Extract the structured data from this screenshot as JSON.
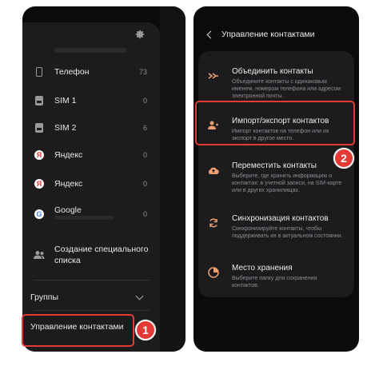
{
  "left": {
    "accounts": [
      {
        "label": "Телефон",
        "count": "73",
        "icon": "phone-icon"
      },
      {
        "label": "SIM 1",
        "count": "0",
        "icon": "sim-icon"
      },
      {
        "label": "SIM 2",
        "count": "6",
        "icon": "sim-icon"
      },
      {
        "label": "Яндекс",
        "count": "0",
        "icon": "yandex-icon"
      },
      {
        "label": "Яндекс",
        "count": "0",
        "icon": "yandex-icon"
      },
      {
        "label": "Google",
        "count": "0",
        "icon": "google-icon"
      }
    ],
    "create_list": "Создание специального списка",
    "groups": "Группы",
    "manage": "Управление контактами",
    "badge": "1"
  },
  "right": {
    "title": "Управление контактами",
    "options": [
      {
        "title": "Объединить контакты",
        "desc": "Объедините контакты с одинаковым именем, номером телефона или адресом электронной почты.",
        "icon": "merge-icon"
      },
      {
        "title": "Импорт/экспорт контактов",
        "desc": "Импорт контактов на телефон или их экспорт в другое место.",
        "icon": "import-export-icon"
      },
      {
        "title": "Переместить контакты",
        "desc": "Выберите, где хранить информацию о контактах: в учетной записи, на SIM-карте или в других хранилищах.",
        "icon": "move-icon"
      },
      {
        "title": "Синхронизация контактов",
        "desc": "Синхронизируйте контакты, чтобы поддерживать их в актуальном состоянии.",
        "icon": "sync-icon"
      },
      {
        "title": "Место хранения",
        "desc": "Выберите папку для сохранения контактов.",
        "icon": "storage-icon"
      }
    ],
    "badge": "2"
  },
  "colors": {
    "accent": "#e53935",
    "icon_accent": "#f0a070"
  }
}
